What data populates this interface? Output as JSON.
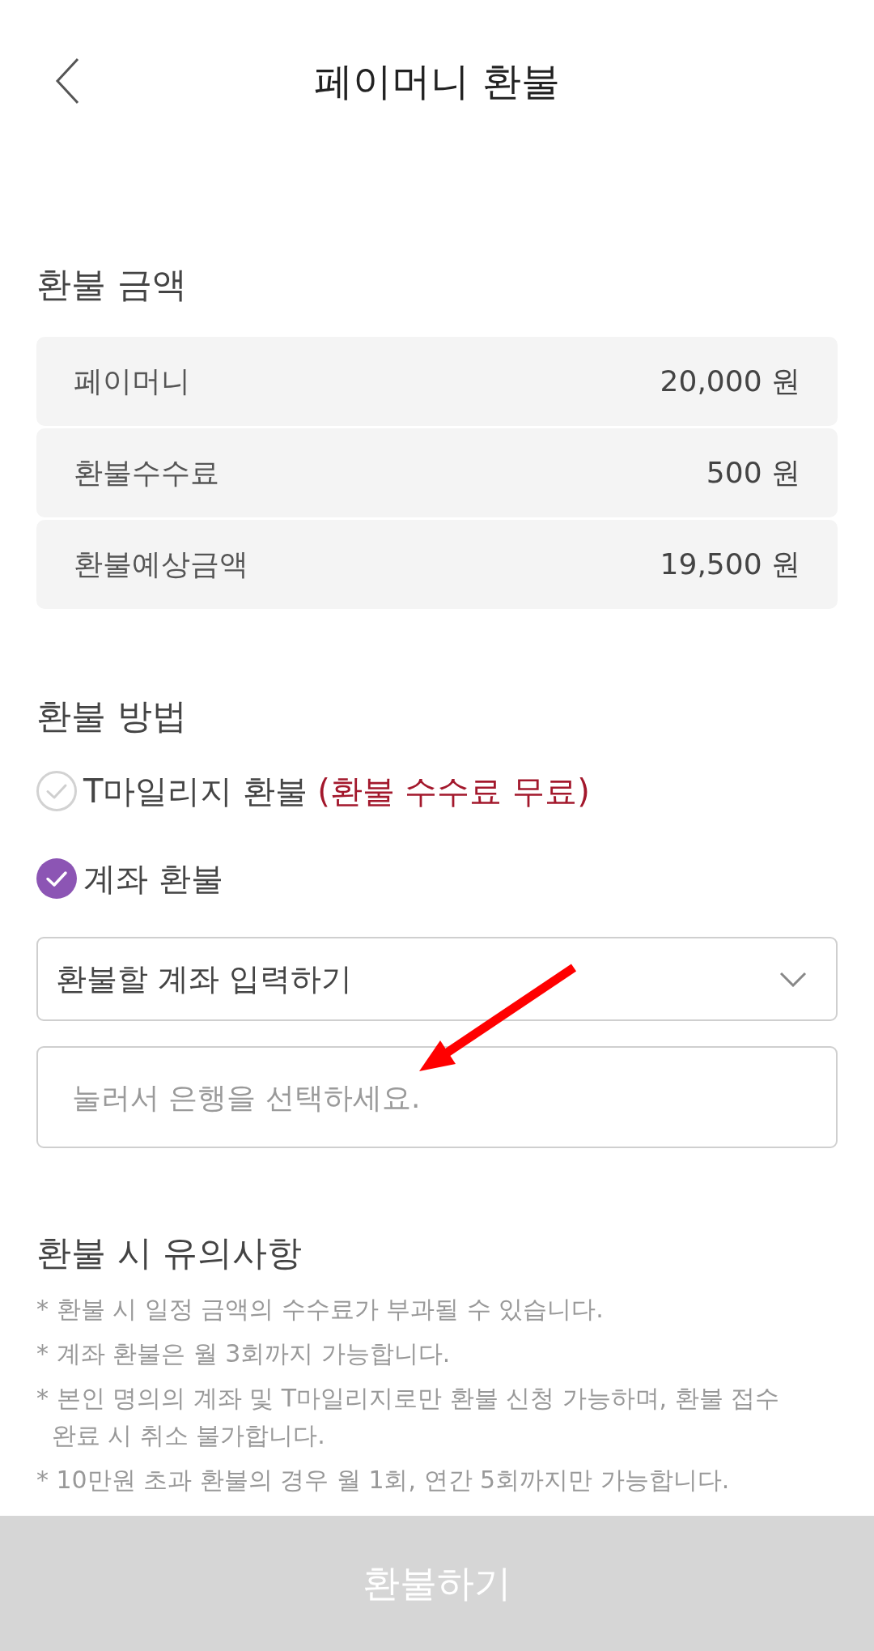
{
  "header": {
    "title": "페이머니 환불"
  },
  "amount_section": {
    "title": "환불 금액",
    "rows": [
      {
        "label": "페이머니",
        "value": "20,000 원"
      },
      {
        "label": "환불수수료",
        "value": "500 원"
      },
      {
        "label": "환불예상금액",
        "value": "19,500 원"
      }
    ]
  },
  "method_section": {
    "title": "환불 방법",
    "options": [
      {
        "label": "T마일리지 환불",
        "note": "(환불 수수료 무료)",
        "selected": false
      },
      {
        "label": "계좌 환불",
        "selected": true
      }
    ],
    "account_select": {
      "value": "환불할 계좌 입력하기"
    },
    "bank_field": {
      "placeholder": "눌러서 은행을 선택하세요."
    }
  },
  "notice_section": {
    "title": "환불 시 유의사항",
    "items": [
      "* 환불 시 일정 금액의 수수료가 부과될 수 있습니다.",
      "* 계좌 환불은 월 3회까지 가능합니다.",
      "* 본인 명의의 계좌 및 T마일리지로만 환불 신청 가능하며, 환불 접수 완료 시 취소 불가합니다.",
      "* 10만원 초과 환불의 경우 월 1회, 연간 5회까지만 가능합니다."
    ]
  },
  "submit_button": {
    "label": "환불하기",
    "disabled": true
  }
}
